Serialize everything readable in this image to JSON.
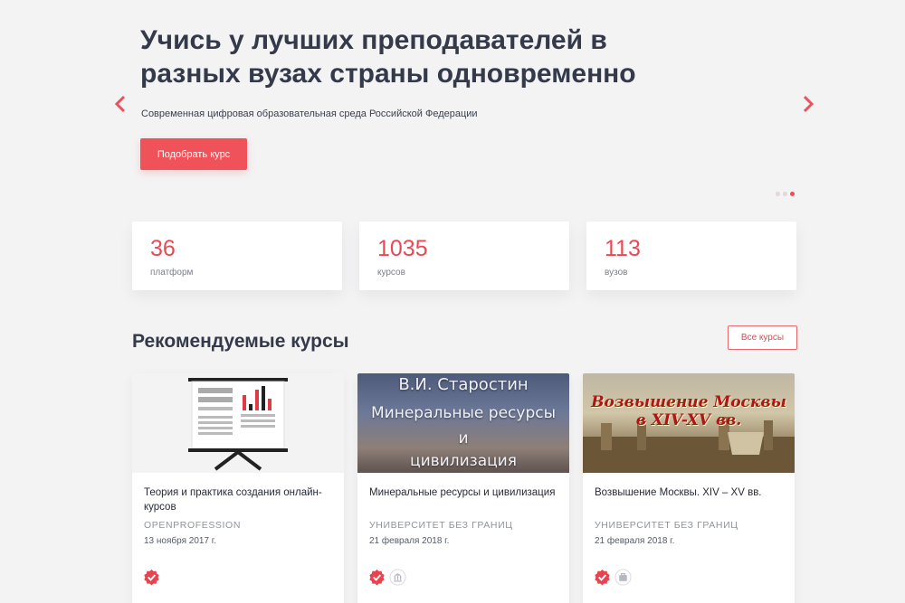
{
  "hero": {
    "title": "Учись у лучших преподавателей в разных вузах страны одновременно",
    "subtitle": "Современная цифровая образовательная среда Российской Федерации",
    "cta_label": "Подобрать курс",
    "slides_count": 3,
    "active_slide": 3
  },
  "stats": [
    {
      "number": "36",
      "label": "платформ"
    },
    {
      "number": "1035",
      "label": "курсов"
    },
    {
      "number": "113",
      "label": "вузов"
    }
  ],
  "recommended": {
    "title": "Рекомендуемые курсы",
    "all_label": "Все курсы"
  },
  "courses": [
    {
      "title": "Теория и практика создания онлайн-курсов",
      "org": "OPENPROFESSION",
      "date": "13 ноября 2017 г.",
      "badges": [
        "verified-badge-icon"
      ]
    },
    {
      "title": "Минеральные ресурсы и цивилизация",
      "org": "УНИВЕРСИТЕТ БЕЗ ГРАНИЦ",
      "date": "21 февраля 2018 г.",
      "image_text": {
        "line1": "В.И. Старостин",
        "line2": "Минеральные ресурсы",
        "line3": "и",
        "line4": "цивилизация"
      },
      "badges": [
        "verified-badge-icon",
        "university-icon"
      ]
    },
    {
      "title": "Возвышение Москвы. XIV – XV вв.",
      "org": "УНИВЕРСИТЕТ БЕЗ ГРАНИЦ",
      "date": "21 февраля 2018 г.",
      "image_text": {
        "line1": "Возвышение Москвы",
        "line2": "в XIV-XV вв."
      },
      "badges": [
        "verified-badge-icon",
        "briefcase-icon"
      ]
    }
  ],
  "colors": {
    "accent": "#f0525a",
    "background": "#f3f3f4",
    "card": "#ffffff"
  }
}
